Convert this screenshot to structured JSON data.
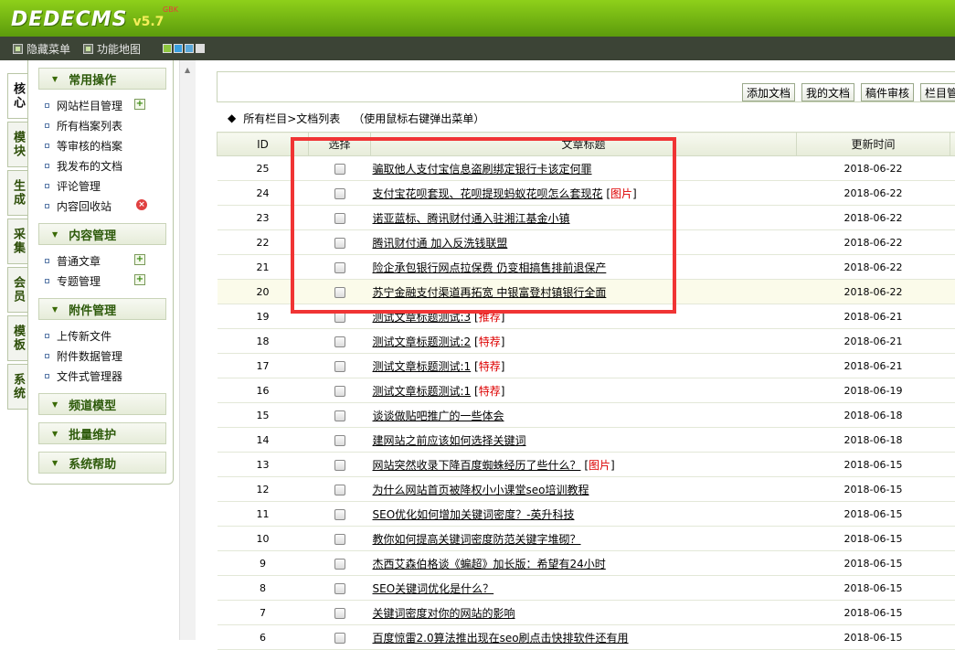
{
  "header": {
    "brand": "DEDECMS",
    "version": "v5.7",
    "sub": "GBK"
  },
  "toolbar": {
    "hide_menu": "隐藏菜单",
    "func_map": "功能地图",
    "swatch_colors": [
      "#8ec63f",
      "#3aa0e0",
      "#5aa8d8",
      "#dddddd"
    ]
  },
  "vtabs": [
    "核心",
    "模块",
    "生成",
    "采集",
    "会员",
    "模板",
    "系统"
  ],
  "menu": {
    "groups": [
      {
        "title": "常用操作",
        "items": [
          {
            "label": "网站栏目管理",
            "action": "add"
          },
          {
            "label": "所有档案列表"
          },
          {
            "label": "等审核的档案"
          },
          {
            "label": "我发布的文档"
          },
          {
            "label": "评论管理"
          },
          {
            "label": "内容回收站",
            "action": "del"
          }
        ]
      },
      {
        "title": "内容管理",
        "items": [
          {
            "label": "普通文章",
            "action": "add"
          },
          {
            "label": "专题管理",
            "action": "add"
          }
        ]
      },
      {
        "title": "附件管理",
        "items": [
          {
            "label": "上传新文件"
          },
          {
            "label": "附件数据管理"
          },
          {
            "label": "文件式管理器"
          }
        ]
      },
      {
        "title": "频道模型",
        "items": []
      },
      {
        "title": "批量维护",
        "items": []
      },
      {
        "title": "系统帮助",
        "items": []
      }
    ]
  },
  "actions": {
    "add_doc": "添加文档",
    "my_doc": "我的文档",
    "review": "稿件审核",
    "column_mgr": "栏目管"
  },
  "path": {
    "label": "所有栏目>文档列表",
    "hint": "（使用鼠标右键弹出菜单）"
  },
  "table": {
    "headers": {
      "id": "ID",
      "select": "选择",
      "title": "文章标题",
      "time": "更新时间"
    },
    "rows": [
      {
        "id": "25",
        "title": "骗取他人支付宝信息盗刷绑定银行卡该定何罪",
        "flag": "",
        "time": "2018-06-22"
      },
      {
        "id": "24",
        "title": "支付宝花呗套现、花呗提现蚂蚁花呗怎么套现花",
        "flag": "图片",
        "time": "2018-06-22"
      },
      {
        "id": "23",
        "title": "诺亚蓝标、腾讯财付通入驻湘江基金小镇",
        "flag": "",
        "time": "2018-06-22"
      },
      {
        "id": "22",
        "title": "腾讯财付通 加入反洗钱联盟",
        "flag": "",
        "time": "2018-06-22"
      },
      {
        "id": "21",
        "title": "险企承包银行网点拉保费 仍变相搞售排前退保产",
        "flag": "",
        "time": "2018-06-22"
      },
      {
        "id": "20",
        "title": "苏宁金融支付渠道再拓宽 中银富登村镇银行全面",
        "flag": "",
        "time": "2018-06-22"
      },
      {
        "id": "19",
        "title": "测试文章标题测试:3",
        "flag": "推荐",
        "time": "2018-06-21"
      },
      {
        "id": "18",
        "title": "测试文章标题测试:2",
        "flag": "特荐",
        "time": "2018-06-21"
      },
      {
        "id": "17",
        "title": "测试文章标题测试:1",
        "flag": "特荐",
        "time": "2018-06-21"
      },
      {
        "id": "16",
        "title": "测试文章标题测试:1",
        "flag": "特荐",
        "time": "2018-06-19"
      },
      {
        "id": "15",
        "title": "谈谈做贴吧推广的一些体会",
        "flag": "",
        "time": "2018-06-18"
      },
      {
        "id": "14",
        "title": "建网站之前应该如何选择关键词",
        "flag": "",
        "time": "2018-06-18"
      },
      {
        "id": "13",
        "title": "网站突然收录下降百度蜘蛛经历了些什么？",
        "flag": "图片",
        "time": "2018-06-15"
      },
      {
        "id": "12",
        "title": "为什么网站首页被降权小小课堂seo培训教程",
        "flag": "",
        "time": "2018-06-15"
      },
      {
        "id": "11",
        "title": "SEO优化如何增加关键词密度？-英升科技",
        "flag": "",
        "time": "2018-06-15"
      },
      {
        "id": "10",
        "title": "教你如何提高关键词密度防范关键字堆砌？",
        "flag": "",
        "time": "2018-06-15"
      },
      {
        "id": "9",
        "title": "杰西艾森伯格谈《蝙超》加长版：希望有24小时",
        "flag": "",
        "time": "2018-06-15"
      },
      {
        "id": "8",
        "title": "SEO关键词优化是什么？",
        "flag": "",
        "time": "2018-06-15"
      },
      {
        "id": "7",
        "title": "关键词密度对你的网站的影响",
        "flag": "",
        "time": "2018-06-15"
      },
      {
        "id": "6",
        "title": "百度惊雷2.0算法推出现在seo刷点击快排软件还有用",
        "flag": "",
        "time": "2018-06-15"
      }
    ]
  },
  "colors": {
    "accent_green": "#6fb012",
    "annotation_red": "#f03434",
    "flag_red": "#dd0000"
  }
}
